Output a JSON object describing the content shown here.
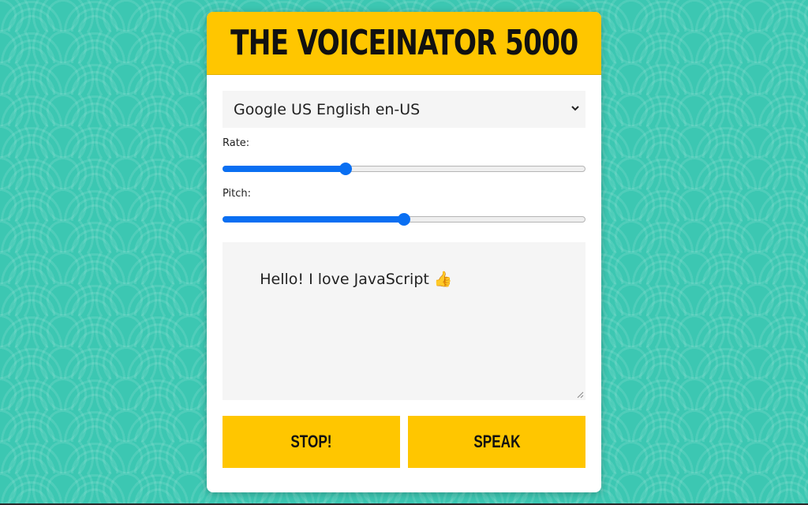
{
  "app": {
    "title": "THE VOICEINATOR 5000"
  },
  "voice_select": {
    "selected": "Google US English en-US",
    "icon": "chevron-down-icon"
  },
  "rate": {
    "label": "Rate:",
    "fraction": 0.34
  },
  "pitch": {
    "label": "Pitch:",
    "fraction": 0.5
  },
  "message": {
    "value": "Hello! I love JavaScript 👍"
  },
  "buttons": {
    "stop_label": "STOP!",
    "speak_label": "SPEAK"
  },
  "colors": {
    "background": "#3cc7b2",
    "accent": "#ffc600",
    "slider": "#0a6ff2"
  }
}
